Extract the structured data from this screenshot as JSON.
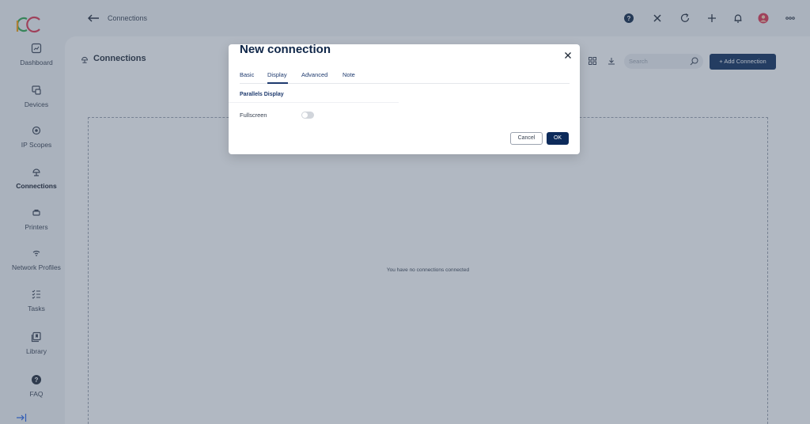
{
  "app": {
    "brand_colors": [
      "#2fa84f",
      "#e0334f",
      "#f59e0b",
      "#2563eb"
    ]
  },
  "topbar": {
    "breadcrumb": "Connections",
    "icons": [
      "help-icon",
      "tools-icon",
      "refresh-icon",
      "plus-icon",
      "bell-icon",
      "avatar",
      "more-icon"
    ]
  },
  "sidebar": {
    "items": [
      {
        "label": "Dashboard",
        "icon": "dashboard-icon"
      },
      {
        "label": "Devices",
        "icon": "devices-icon"
      },
      {
        "label": "IP Scopes",
        "icon": "ip-scopes-icon"
      },
      {
        "label": "Connections",
        "icon": "connections-icon",
        "active": true
      },
      {
        "label": "Printers",
        "icon": "printer-icon"
      },
      {
        "label": "Network Profiles",
        "icon": "wifi-icon"
      },
      {
        "label": "Tasks",
        "icon": "tasks-icon"
      },
      {
        "label": "Library",
        "icon": "library-icon"
      },
      {
        "label": "FAQ",
        "icon": "help-icon"
      }
    ]
  },
  "main": {
    "title": "Connections",
    "search_placeholder": "Search",
    "add_button": "+ Add Connection",
    "empty_message": "You have no connections connected"
  },
  "modal": {
    "title": "New connection",
    "tabs": [
      {
        "label": "Basic"
      },
      {
        "label": "Display",
        "active": true
      },
      {
        "label": "Advanced"
      },
      {
        "label": "Note"
      }
    ],
    "section_title": "Parallels Display",
    "fullscreen_label": "Fullscreen",
    "fullscreen_enabled": false,
    "cancel_label": "Cancel",
    "ok_label": "OK"
  },
  "colors": {
    "primary": "#0d2b5b",
    "overlay": "rgba(70,85,110,0.42)"
  }
}
